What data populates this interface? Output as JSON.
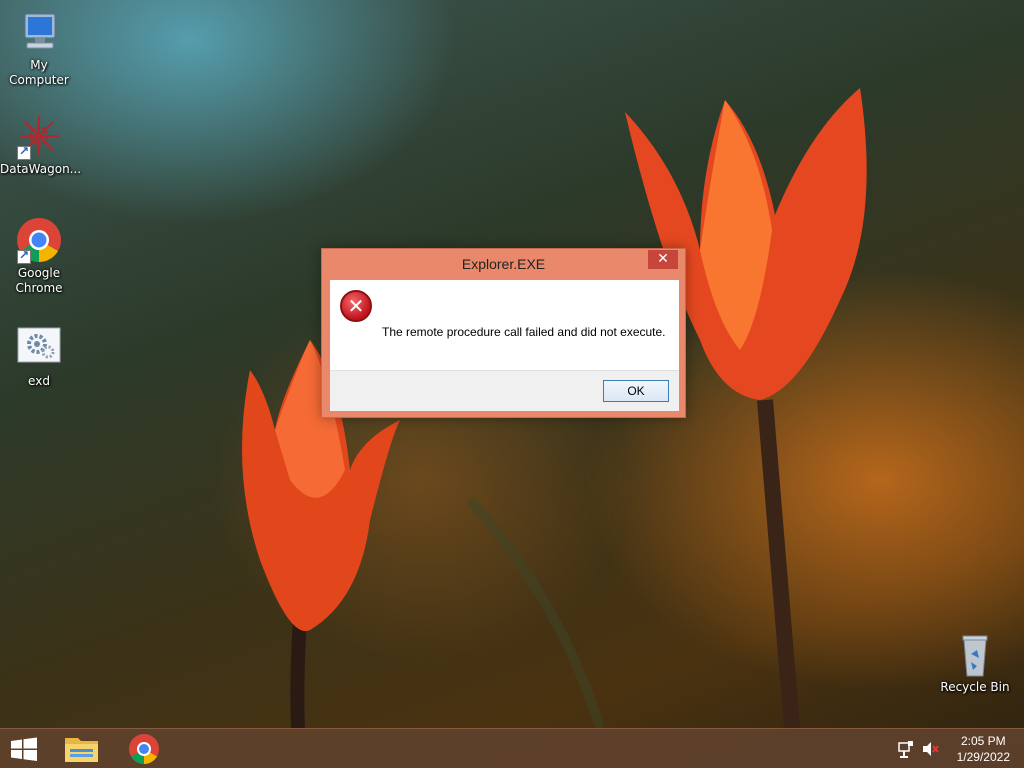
{
  "desktop": {
    "icons": [
      {
        "label": "My Computer",
        "icon": "computer-icon"
      },
      {
        "label": "DataWagon...",
        "icon": "datawagon-icon"
      },
      {
        "label": "Google Chrome",
        "icon": "chrome-icon"
      },
      {
        "label": "exd",
        "icon": "settings-file-icon"
      },
      {
        "label": "Recycle Bin",
        "icon": "recycle-bin-icon"
      }
    ]
  },
  "dialog": {
    "title": "Explorer.EXE",
    "close_glyph": "✕",
    "error_glyph": "✕",
    "message": "The remote procedure call failed and did not execute.",
    "ok_label": "OK"
  },
  "taskbar": {
    "time": "2:05 PM",
    "date": "1/29/2022",
    "pinned": [
      "file-explorer-icon",
      "chrome-icon"
    ]
  },
  "colors": {
    "dialog_frame": "#e9886a",
    "close_button": "#c7463b",
    "taskbar": "#5f412d"
  }
}
